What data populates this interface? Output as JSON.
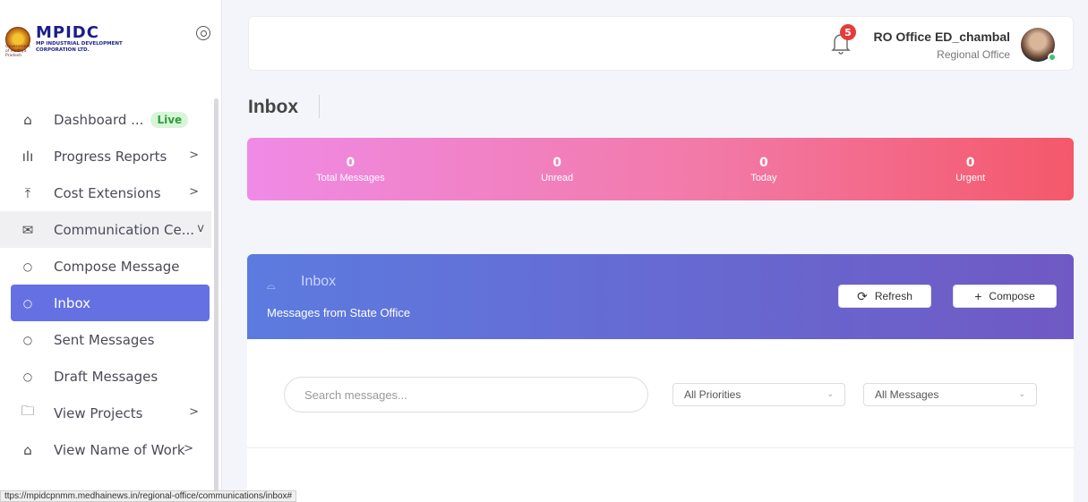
{
  "logo": {
    "mark": "MPIDC",
    "subtitle_1": "MP INDUSTRIAL DEVELOPMENT",
    "subtitle_2": "CORPORATION LTD.",
    "gov_text": "Government of Madhya Pradesh"
  },
  "sidebar": {
    "items": [
      {
        "label": "Dashboard ...",
        "icon": "home-icon",
        "badge": "Live"
      },
      {
        "label": "Progress Reports",
        "icon": "bar-chart-icon",
        "chevron": ">"
      },
      {
        "label": "Cost Extensions",
        "icon": "upload-icon",
        "chevron": ">"
      },
      {
        "label": "Communication Ce...",
        "icon": "mail-icon",
        "chevron": "v"
      },
      {
        "label": "Compose Message",
        "icon": "circle-icon"
      },
      {
        "label": "Inbox",
        "icon": "circle-icon"
      },
      {
        "label": "Sent Messages",
        "icon": "circle-icon"
      },
      {
        "label": "Draft Messages",
        "icon": "circle-icon"
      },
      {
        "label": "View Projects",
        "icon": "folder-icon",
        "chevron": ">"
      },
      {
        "label": "View Name of Work",
        "icon": "building-icon",
        "chevron": ">"
      }
    ]
  },
  "header": {
    "notification_count": "5",
    "user_name": "RO Office ED_chambal",
    "user_role": "Regional Office"
  },
  "page": {
    "title": "Inbox"
  },
  "stats": [
    {
      "value": "0",
      "label": "Total Messages"
    },
    {
      "value": "0",
      "label": "Unread"
    },
    {
      "value": "0",
      "label": "Today"
    },
    {
      "value": "0",
      "label": "Urgent"
    }
  ],
  "inbox_card": {
    "title": "Inbox",
    "subtitle": "Messages from State Office",
    "refresh_label": "Refresh",
    "compose_label": "Compose",
    "search_placeholder": "Search messages...",
    "priority_filter": "All Priorities",
    "message_filter": "All Messages"
  },
  "status_url": "ttps://mpidcpnmm.medhainews.in/regional-office/communications/inbox#",
  "colors": {
    "accent": "#6571e3",
    "stats_gradient_start": "#f08ae6",
    "stats_gradient_end": "#f4586a",
    "card_gradient_start": "#5c7be0",
    "card_gradient_end": "#7059c4",
    "badge_red": "#e43b3b",
    "online_green": "#3bc46b"
  }
}
